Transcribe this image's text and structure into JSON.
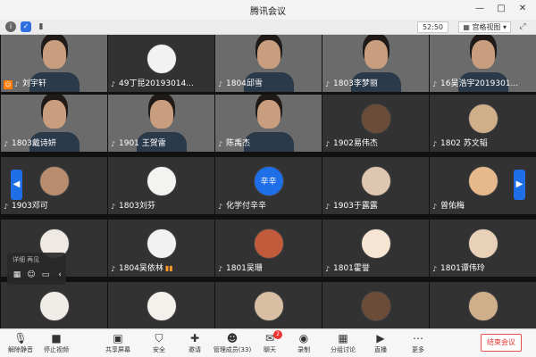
{
  "window": {
    "title": "腾讯会议"
  },
  "infobar": {
    "timer": "52:50",
    "view_label": "宫格视图"
  },
  "participants": [
    {
      "name": "刘宇轩",
      "host": true
    },
    {
      "name": "49丁昆20193014..."
    },
    {
      "name": "1804邱雪"
    },
    {
      "name": "1803李梦丽"
    },
    {
      "name": "16吴浩宇2019301..."
    },
    {
      "name": "1803戴诗妍"
    },
    {
      "name": "1901 王贺雷"
    },
    {
      "name": "陈禹杰"
    },
    {
      "name": "1902易伟杰"
    },
    {
      "name": "1802 苏文韬"
    },
    {
      "name": "1903邓可"
    },
    {
      "name": "1803刘芬"
    },
    {
      "name": "化学付辛辛",
      "avatar_text": "辛辛"
    },
    {
      "name": "1903于露露"
    },
    {
      "name": "曾佑梅"
    },
    {
      "name": ""
    },
    {
      "name": "1804吴依林"
    },
    {
      "name": "1801吴珊"
    },
    {
      "name": "1801霍誉"
    },
    {
      "name": "1801谭伟玲"
    },
    {
      "name": ""
    },
    {
      "name": ""
    },
    {
      "name": ""
    },
    {
      "name": ""
    },
    {
      "name": ""
    }
  ],
  "mini_panel": {
    "label": "详细  再见"
  },
  "toolbar": {
    "mute": "解除静音",
    "video": "停止视频",
    "share": "共享屏幕",
    "security": "安全",
    "invite": "邀请",
    "members": "管理成员(33)",
    "chat": "聊天",
    "chat_badge": "2",
    "record": "录制",
    "breakout": "分组讨论",
    "live": "直播",
    "more": "更多",
    "end": "结束会议"
  }
}
